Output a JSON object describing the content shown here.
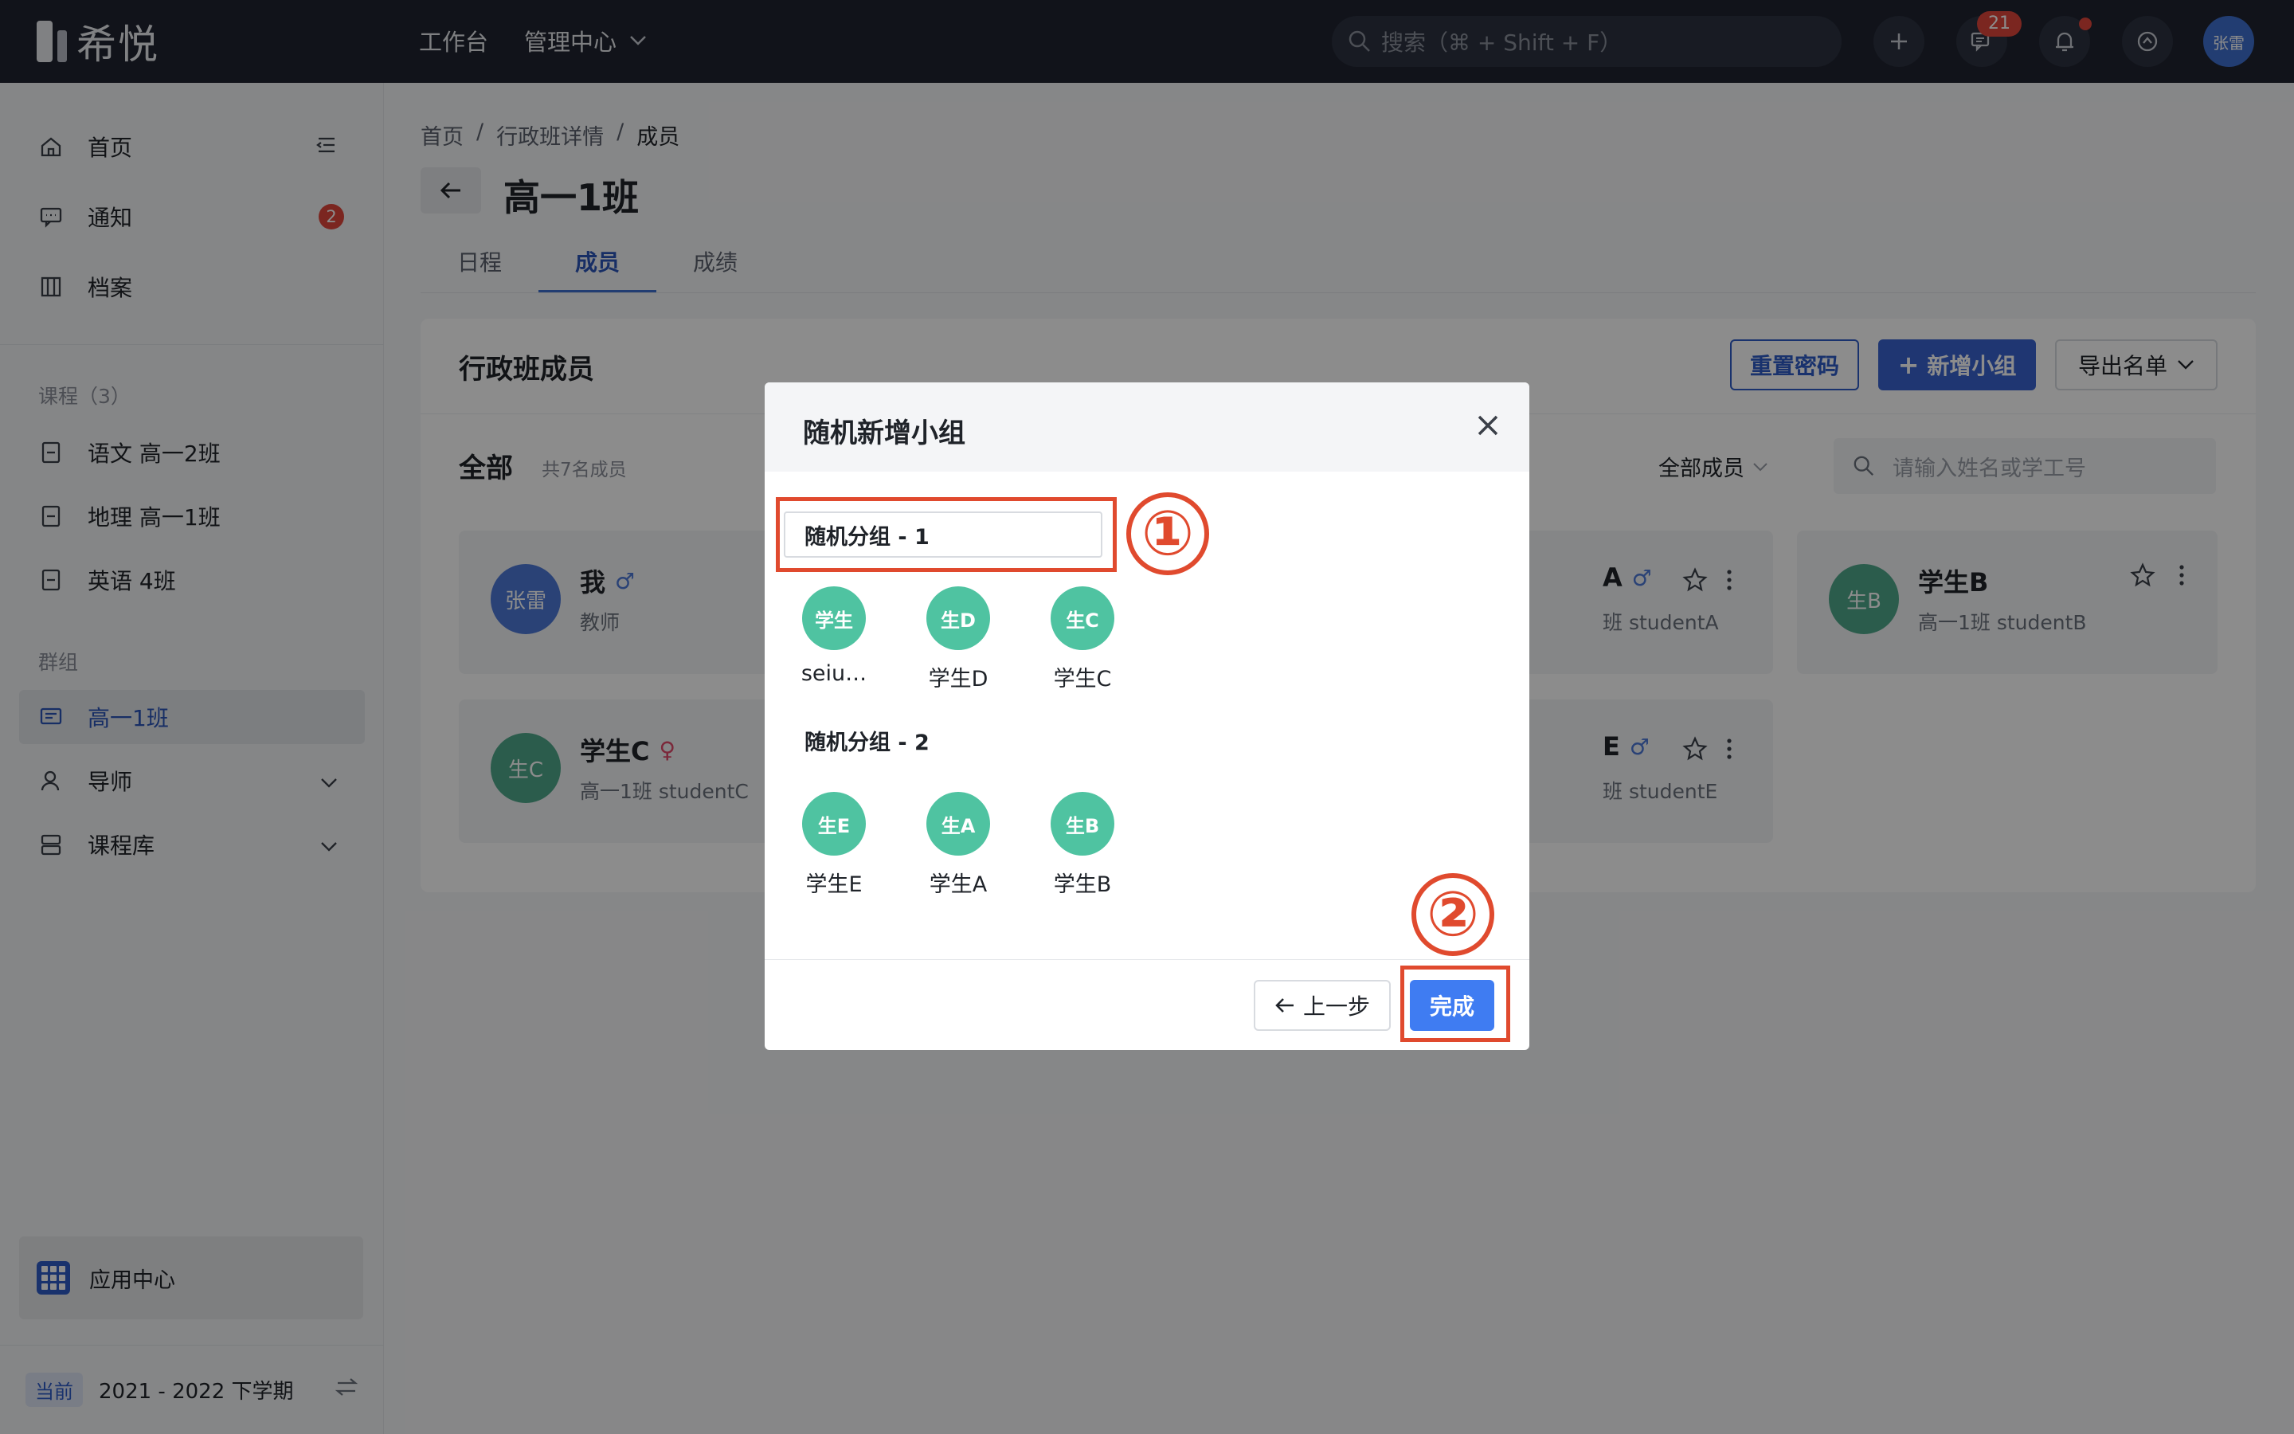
{
  "topbar": {
    "logo_text": "希悦",
    "nav_workbench": "工作台",
    "nav_admin": "管理中心",
    "search_placeholder": "搜索（⌘ + Shift + F）",
    "message_count": "21",
    "avatar_text": "张雷"
  },
  "sidebar": {
    "home": "首页",
    "notice": "通知",
    "notice_badge": "2",
    "archive": "档案",
    "courses_section": "课程（3）",
    "courses": [
      "语文 高一2班",
      "地理 高一1班",
      "英语 4班"
    ],
    "groups_section": "群组",
    "active_group": "高一1班",
    "mentor": "导师",
    "course_library": "课程库",
    "app_center": "应用中心",
    "term_tag": "当前",
    "term": "2021 - 2022 下学期"
  },
  "main": {
    "breadcrumb": [
      "首页",
      "/",
      "行政班详情",
      "/",
      "成员"
    ],
    "title": "高一1班",
    "tabs": [
      "日程",
      "成员",
      "成绩"
    ],
    "panel_title": "行政班成员",
    "reset_password": "重置密码",
    "new_group": "新增小组",
    "export_list": "导出名单",
    "all_label": "全部",
    "all_count": "共7名成员",
    "filter": "全部成员",
    "member_search_placeholder": "请输入姓名或学工号",
    "cards": [
      {
        "avatar": "张雷",
        "name": "我",
        "sub": "教师",
        "gender": "♂",
        "color": "#4d79d8"
      },
      {
        "avatar": "",
        "name": "A",
        "sub": "班 studentA",
        "gender": "♂",
        "color": "#4fc3a1"
      },
      {
        "avatar": "生B",
        "name": "学生B",
        "sub": "高一1班 studentB",
        "gender": "",
        "color": "#4fc3a1"
      },
      {
        "avatar": "生C",
        "name": "学生C",
        "sub": "高一1班 studentC",
        "gender": "♀",
        "color": "#4fc3a1"
      },
      {
        "avatar": "",
        "name": "E",
        "sub": "班 studentE",
        "gender": "♂",
        "color": "#4fc3a1"
      }
    ]
  },
  "modal": {
    "title": "随机新增小组",
    "group1_name": "随机分组 - 1",
    "group1_members": [
      {
        "avatar": "学生",
        "label": "seiu…"
      },
      {
        "avatar": "生D",
        "label": "学生D"
      },
      {
        "avatar": "生C",
        "label": "学生C"
      }
    ],
    "group2_name": "随机分组 - 2",
    "group2_members": [
      {
        "avatar": "生E",
        "label": "学生E"
      },
      {
        "avatar": "生A",
        "label": "学生A"
      },
      {
        "avatar": "生B",
        "label": "学生B"
      }
    ],
    "prev_button": "上一步",
    "done_button": "完成"
  },
  "annotations": {
    "step1": "①",
    "step2": "②",
    "color": "#e04a2e"
  }
}
